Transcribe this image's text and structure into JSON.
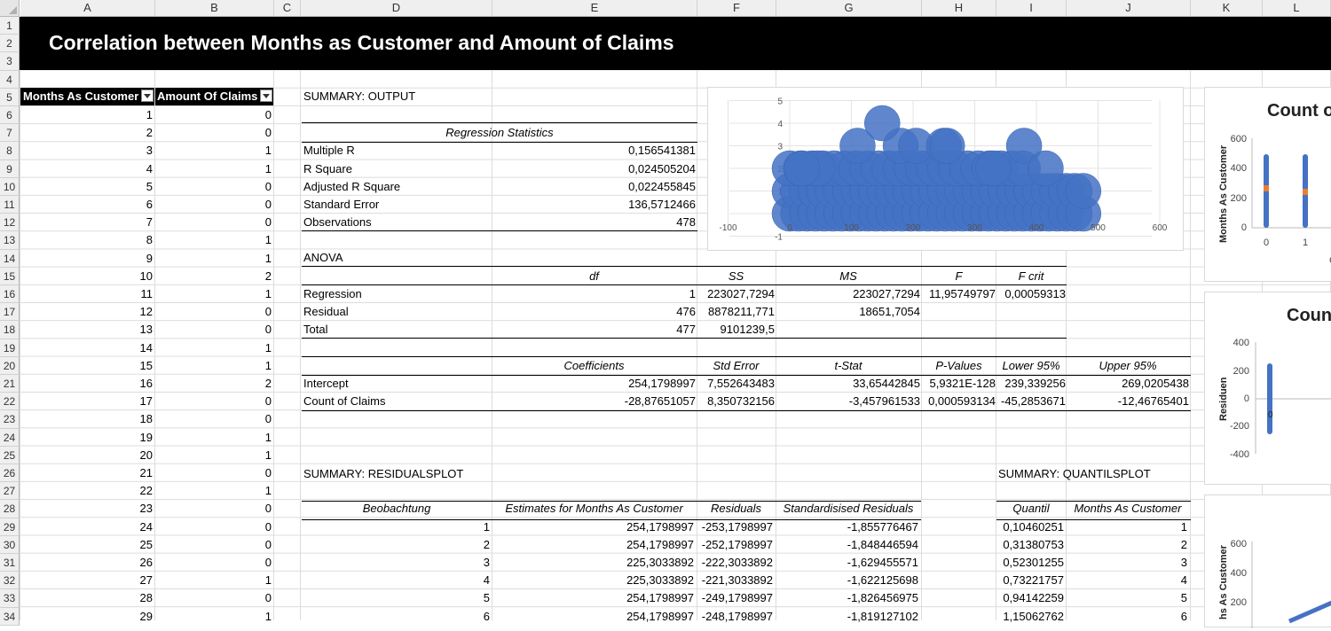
{
  "columns": [
    "A",
    "B",
    "C",
    "D",
    "E",
    "F",
    "G",
    "H",
    "I",
    "J",
    "K",
    "L"
  ],
  "rows": [
    "1",
    "2",
    "3",
    "4",
    "5",
    "6",
    "7",
    "8",
    "9",
    "10",
    "11",
    "12",
    "13",
    "14",
    "15",
    "16",
    "17",
    "18",
    "19",
    "20",
    "21",
    "22",
    "23",
    "24",
    "25",
    "26",
    "27",
    "28",
    "29",
    "30",
    "31",
    "32",
    "33",
    "34"
  ],
  "title": "Correlation between Months as Customer and Amount of Claims",
  "table": {
    "headers": [
      "Months As Customer",
      "Amount Of Claims"
    ],
    "rows": [
      [
        "1",
        "0"
      ],
      [
        "2",
        "0"
      ],
      [
        "3",
        "1"
      ],
      [
        "4",
        "1"
      ],
      [
        "5",
        "0"
      ],
      [
        "6",
        "0"
      ],
      [
        "7",
        "0"
      ],
      [
        "8",
        "1"
      ],
      [
        "9",
        "1"
      ],
      [
        "10",
        "2"
      ],
      [
        "11",
        "1"
      ],
      [
        "12",
        "0"
      ],
      [
        "13",
        "0"
      ],
      [
        "14",
        "1"
      ],
      [
        "15",
        "1"
      ],
      [
        "16",
        "2"
      ],
      [
        "17",
        "0"
      ],
      [
        "18",
        "0"
      ],
      [
        "19",
        "1"
      ],
      [
        "20",
        "1"
      ],
      [
        "21",
        "0"
      ],
      [
        "22",
        "1"
      ],
      [
        "23",
        "0"
      ],
      [
        "24",
        "0"
      ],
      [
        "25",
        "0"
      ],
      [
        "26",
        "0"
      ],
      [
        "27",
        "1"
      ],
      [
        "28",
        "0"
      ],
      [
        "29",
        "1"
      ]
    ]
  },
  "summary": {
    "title": "SUMMARY: OUTPUT",
    "regression_title": "Regression Statistics",
    "stats": [
      [
        "Multiple R",
        "0,156541381"
      ],
      [
        "R Square",
        "0,024505204"
      ],
      [
        "Adjusted R Square",
        "0,022455845"
      ],
      [
        "Standard Error",
        "136,5712466"
      ],
      [
        "Observations",
        "478"
      ]
    ]
  },
  "anova": {
    "title": "ANOVA",
    "headers": [
      "df",
      "SS",
      "MS",
      "F",
      "F crit"
    ],
    "rows": [
      [
        "Regression",
        "1",
        "223027,7294",
        "223027,7294",
        "11,95749797",
        "0,00059313"
      ],
      [
        "Residual",
        "476",
        "8878211,771",
        "18651,7054",
        "",
        ""
      ],
      [
        "Total",
        "477",
        "9101239,5",
        "",
        "",
        ""
      ]
    ]
  },
  "coef": {
    "headers": [
      "Coefficients",
      "Std Error",
      "t-Stat",
      "P-Values",
      "Lower 95%",
      "Upper 95%"
    ],
    "rows": [
      [
        "Intercept",
        "254,1798997",
        "7,552643483",
        "33,65442845",
        "5,9321E-128",
        "239,339256",
        "269,0205438"
      ],
      [
        "Count of Claims",
        "-28,87651057",
        "8,350732156",
        "-3,457961533",
        "0,000593134",
        "-45,2853671",
        "-12,46765401"
      ]
    ]
  },
  "residuals": {
    "title": "SUMMARY: RESIDUALSPLOT",
    "headers": [
      "Beobachtung",
      "Estimates for Months As Customer",
      "Residuals",
      "Standardisised Residuals"
    ],
    "rows": [
      [
        "1",
        "254,1798997",
        "-253,1798997",
        "-1,855776467"
      ],
      [
        "2",
        "254,1798997",
        "-252,1798997",
        "-1,848446594"
      ],
      [
        "3",
        "225,3033892",
        "-222,3033892",
        "-1,629455571"
      ],
      [
        "4",
        "225,3033892",
        "-221,3033892",
        "-1,622125698"
      ],
      [
        "5",
        "254,1798997",
        "-249,1798997",
        "-1,826456975"
      ],
      [
        "6",
        "254,1798997",
        "-248,1798997",
        "-1,819127102"
      ]
    ]
  },
  "quantil": {
    "title": "SUMMARY: QUANTILSPLOT",
    "headers": [
      "Quantil",
      "Months As Customer"
    ],
    "rows": [
      [
        "0,10460251",
        "1"
      ],
      [
        "0,31380753",
        "2"
      ],
      [
        "0,52301255",
        "3"
      ],
      [
        "0,73221757",
        "4"
      ],
      [
        "0,94142259",
        "5"
      ],
      [
        "1,15062762",
        "6"
      ]
    ]
  },
  "charts": {
    "bubble": {
      "y_ticks": [
        "5",
        "4",
        "3",
        "2",
        "1",
        "-1"
      ],
      "x_ticks": [
        "-100",
        "0",
        "100",
        "200",
        "300",
        "400",
        "500",
        "600"
      ],
      "color": "#4472c4"
    },
    "right1": {
      "title": "Count o",
      "ylabel": "Months As Customer",
      "y_ticks": [
        "600",
        "400",
        "200",
        "0"
      ],
      "x_ticks": [
        "0",
        "1"
      ],
      "x_label_frag": "C"
    },
    "right2": {
      "title": "Coun",
      "ylabel": "Residuen",
      "y_ticks": [
        "400",
        "200",
        "0",
        "-200",
        "-400"
      ],
      "point_label": "0"
    },
    "right3": {
      "ylabel": "hs As Customer",
      "y_ticks": [
        "600",
        "400",
        "200"
      ]
    }
  },
  "colors": {
    "accent": "#4472c4",
    "orange": "#ed7d31",
    "header_bg": "#000000"
  }
}
